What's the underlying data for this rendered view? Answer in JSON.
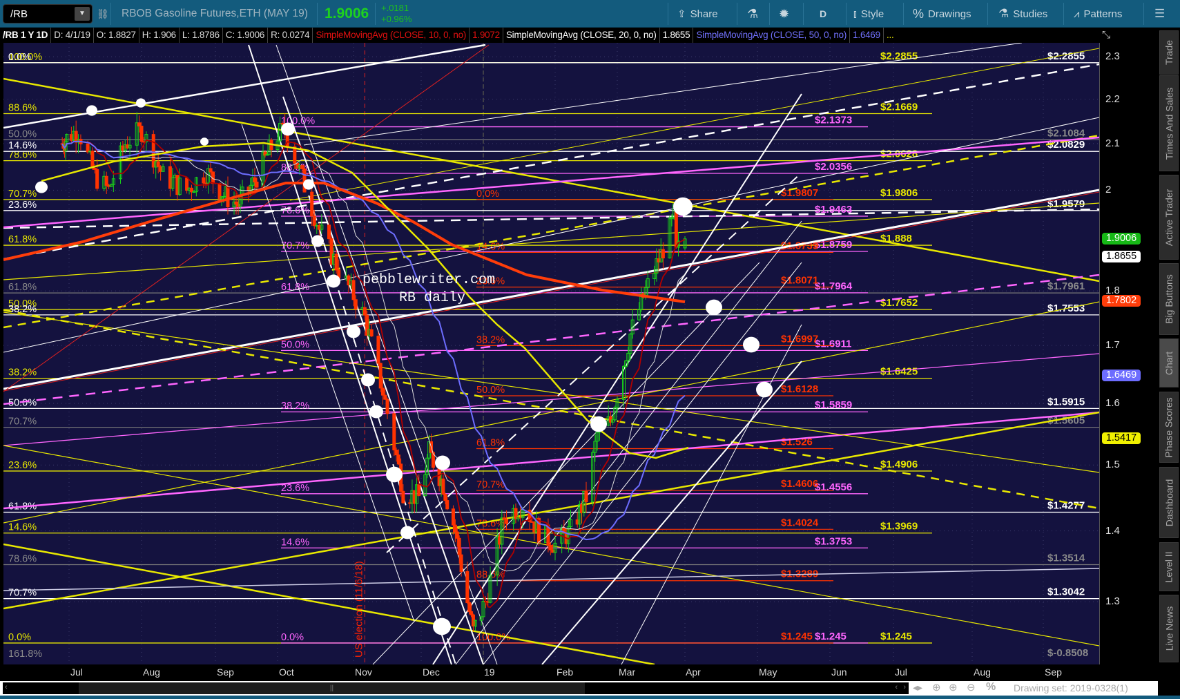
{
  "toolbar": {
    "symbol": "/RB",
    "description": "RBOB Gasoline Futures,ETH (MAY 19)",
    "last_price": "1.9006",
    "change": "+.0181",
    "change_pct": "+0.96%",
    "share_label": "Share",
    "aggregation_label": "D",
    "style_label": "Style",
    "drawings_label": "Drawings",
    "studies_label": "Studies",
    "patterns_label": "Patterns"
  },
  "infobar": {
    "title": "/RB 1 Y 1D",
    "date": "D: 4/1/19",
    "open": "O: 1.8827",
    "high": "H: 1.906",
    "low": "L: 1.8786",
    "close": "C: 1.9006",
    "range": "R: 0.0274",
    "sma10_label": "SimpleMovingAvg (CLOSE, 10, 0, no)",
    "sma10_value": "1.9072",
    "sma20_label": "SimpleMovingAvg (CLOSE, 20, 0, no)",
    "sma20_value": "1.8655",
    "sma50_label": "SimpleMovingAvg (CLOSE, 50, 0, no)",
    "sma50_value": "1.6469",
    "more": "..."
  },
  "price_axis": {
    "ticks": [
      "2.3",
      "2.2",
      "2.1",
      "2",
      "1.8",
      "1.7",
      "1.6",
      "1.5",
      "1.4",
      "1.3"
    ],
    "tick_values": [
      2.3,
      2.2,
      2.1,
      2.0,
      1.8,
      1.7,
      1.6,
      1.5,
      1.4,
      1.3
    ],
    "badges": [
      {
        "label": "1.9006",
        "value": 1.9006,
        "bg": "#16b816",
        "fg": "#ffffff"
      },
      {
        "label": "1.8655",
        "value": 1.8655,
        "bg": "#ffffff",
        "fg": "#000000"
      },
      {
        "label": "1.7802",
        "value": 1.7802,
        "bg": "#ff3d0a",
        "fg": "#ffffff"
      },
      {
        "label": "1.6469",
        "value": 1.6469,
        "bg": "#6d6dff",
        "fg": "#ffffff"
      },
      {
        "label": "1.5417",
        "value": 1.5417,
        "bg": "#f0f000",
        "fg": "#000000"
      }
    ]
  },
  "time_axis": [
    "Jul",
    "Aug",
    "Sep",
    "Oct",
    "Nov",
    "Dec",
    "19",
    "Feb",
    "Mar",
    "Apr",
    "May",
    "Jun",
    "Jul",
    "Aug",
    "Sep"
  ],
  "sidebar": [
    "Trade",
    "Times And Sales",
    "Active Trader",
    "Big Buttons",
    "Chart",
    "Phase Scores",
    "Dashboard",
    "Level II",
    "Live News"
  ],
  "sidebar_active": "Chart",
  "bottom": {
    "drawing_set": "Drawing set: 2019-0328(1)"
  },
  "annotations": {
    "watermark_1": "pebblewriter.com",
    "watermark_2": "RB daily",
    "event": "US election (11/6/18)"
  },
  "chart_data": {
    "type": "candlestick",
    "symbol": "/RB",
    "scale": "log",
    "ylim": [
      1.2,
      2.35
    ],
    "price_path": [
      [
        "2018-06-25",
        2.1
      ],
      [
        "2018-07-05",
        2.13
      ],
      [
        "2018-07-12",
        2.03
      ],
      [
        "2018-07-18",
        2.0
      ],
      [
        "2018-07-25",
        2.1
      ],
      [
        "2018-08-01",
        2.13
      ],
      [
        "2018-08-10",
        2.03
      ],
      [
        "2018-08-20",
        2.0
      ],
      [
        "2018-08-28",
        2.04
      ],
      [
        "2018-09-05",
        1.99
      ],
      [
        "2018-09-12",
        1.97
      ],
      [
        "2018-09-20",
        2.02
      ],
      [
        "2018-10-01",
        2.12
      ],
      [
        "2018-10-04",
        2.13
      ],
      [
        "2018-10-10",
        2.04
      ],
      [
        "2018-10-18",
        1.92
      ],
      [
        "2018-10-26",
        1.84
      ],
      [
        "2018-11-06",
        1.75
      ],
      [
        "2018-11-14",
        1.62
      ],
      [
        "2018-11-23",
        1.46
      ],
      [
        "2018-11-30",
        1.45
      ],
      [
        "2018-12-05",
        1.52
      ],
      [
        "2018-12-12",
        1.47
      ],
      [
        "2018-12-18",
        1.4
      ],
      [
        "2018-12-24",
        1.3
      ],
      [
        "2018-12-27",
        1.26
      ],
      [
        "2019-01-02",
        1.3
      ],
      [
        "2019-01-10",
        1.42
      ],
      [
        "2019-01-18",
        1.44
      ],
      [
        "2019-01-25",
        1.4
      ],
      [
        "2019-02-01",
        1.38
      ],
      [
        "2019-02-08",
        1.4
      ],
      [
        "2019-02-15",
        1.45
      ],
      [
        "2019-02-20",
        1.55
      ],
      [
        "2019-02-26",
        1.57
      ],
      [
        "2019-03-01",
        1.62
      ],
      [
        "2019-03-07",
        1.72
      ],
      [
        "2019-03-14",
        1.8
      ],
      [
        "2019-03-21",
        1.87
      ],
      [
        "2019-03-26",
        1.93
      ],
      [
        "2019-03-27",
        1.95
      ],
      [
        "2019-03-28",
        1.87
      ],
      [
        "2019-03-29",
        1.88
      ],
      [
        "2019-04-01",
        1.9006
      ]
    ],
    "last_bar": {
      "date": "4/1/19",
      "open": 1.8827,
      "high": 1.906,
      "low": 1.8786,
      "close": 1.9006
    },
    "studies": [
      {
        "name": "SMA 10",
        "value": 1.9072,
        "color": "#b00000"
      },
      {
        "name": "SMA 20",
        "value": 1.8655,
        "color": "#dddddd"
      },
      {
        "name": "SMA 50",
        "value": 1.6469,
        "color": "#6d6dff"
      }
    ],
    "event_date": "2018-11-06",
    "fib_sets": [
      {
        "id": "yellow",
        "color": "#e8e800",
        "levels": [
          {
            "pct": "100.0%",
            "price": 2.2855,
            "price_label": "$2.2855"
          },
          {
            "pct": "88.6%",
            "price": 2.1669,
            "price_label": "$2.1669"
          },
          {
            "pct": "78.6%",
            "price": 2.0628,
            "price_label": "$2.0628"
          },
          {
            "pct": "70.7%",
            "price": 1.9806,
            "price_label": "$1.9806"
          },
          {
            "pct": "61.8%",
            "price": 1.888,
            "price_label": "$1.888"
          },
          {
            "pct": "50.0%",
            "price": 1.7652,
            "price_label": "$1.7652"
          },
          {
            "pct": "38.2%",
            "price": 1.6425,
            "price_label": "$1.6425"
          },
          {
            "pct": "23.6%",
            "price": 1.4906,
            "price_label": "$1.4906"
          },
          {
            "pct": "14.6%",
            "price": 1.3969,
            "price_label": "$1.3969"
          },
          {
            "pct": "0.0%",
            "price": 1.245,
            "price_label": "$1.245"
          }
        ]
      },
      {
        "id": "white",
        "color": "#ffffff",
        "levels": [
          {
            "pct": "0.0%",
            "price": 2.2855,
            "price_label": "$2.2855"
          },
          {
            "pct": "14.6%",
            "price": 2.0829,
            "price_label": "$2.0829"
          },
          {
            "pct": "23.6%",
            "price": 1.9579,
            "price_label": "$1.9579"
          },
          {
            "pct": "38.2%",
            "price": 1.7553,
            "price_label": "$1.7553"
          },
          {
            "pct": "50.0%",
            "price": 1.5915,
            "price_label": "$1.5915"
          },
          {
            "pct": "61.8%",
            "price": 1.4277,
            "price_label": "$1.4277"
          },
          {
            "pct": "70.7%",
            "price": 1.3042,
            "price_label": "$1.3042"
          }
        ]
      },
      {
        "id": "gray",
        "color": "#7a7a7a",
        "levels": [
          {
            "pct": "50.0%",
            "price": 2.1084,
            "price_label": "$2.1084"
          },
          {
            "pct": "61.8%",
            "price": 1.7961,
            "price_label": "$1.7961"
          },
          {
            "pct": "70.7%",
            "price": 1.5605,
            "price_label": "$1.5605"
          },
          {
            "pct": "78.6%",
            "price": 1.3514,
            "price_label": "$1.3514"
          },
          {
            "pct": "161.8%",
            "price": -0.8508,
            "price_label": "$-0.8508"
          }
        ]
      },
      {
        "id": "magenta",
        "color": "#ff66ff",
        "levels": [
          {
            "pct": "100.0%",
            "price": 2.1373,
            "price_label": "$2.1373"
          },
          {
            "pct": "88.6%",
            "price": 2.0356,
            "price_label": "$2.0356"
          },
          {
            "pct": "78.6%",
            "price": 1.9463,
            "price_label": "$1.9463"
          },
          {
            "pct": "70.7%",
            "price": 1.8759,
            "price_label": "$1.8759"
          },
          {
            "pct": "61.8%",
            "price": 1.7964,
            "price_label": "$1.7964"
          },
          {
            "pct": "50.0%",
            "price": 1.6911,
            "price_label": "$1.6911"
          },
          {
            "pct": "38.2%",
            "price": 1.5859,
            "price_label": "$1.5859"
          },
          {
            "pct": "23.6%",
            "price": 1.4556,
            "price_label": "$1.4556"
          },
          {
            "pct": "14.6%",
            "price": 1.3753,
            "price_label": "$1.3753"
          },
          {
            "pct": "0.0%",
            "price": 1.245,
            "price_label": "$1.245"
          }
        ]
      },
      {
        "id": "red",
        "color": "#ff3300",
        "levels": [
          {
            "pct": "0.0%",
            "price": 1.9807,
            "price_label": "$1.9807"
          },
          {
            "pct": "14.6%",
            "price": 1.8739,
            "price_label": "$1.8739"
          },
          {
            "pct": "23.6%",
            "price": 1.8071,
            "price_label": "$1.8071"
          },
          {
            "pct": "38.2%",
            "price": 1.6997,
            "price_label": "$1.6997"
          },
          {
            "pct": "50.0%",
            "price": 1.6128,
            "price_label": "$1.6128"
          },
          {
            "pct": "61.8%",
            "price": 1.526,
            "price_label": "$1.526"
          },
          {
            "pct": "70.7%",
            "price": 1.4606,
            "price_label": "$1.4606"
          },
          {
            "pct": "78.6%",
            "price": 1.4024,
            "price_label": "$1.4024"
          },
          {
            "pct": "88.6%",
            "price": 1.3289,
            "price_label": "$1.3289"
          },
          {
            "pct": "100.0%",
            "price": 1.245,
            "price_label": "$1.245"
          }
        ]
      }
    ]
  }
}
